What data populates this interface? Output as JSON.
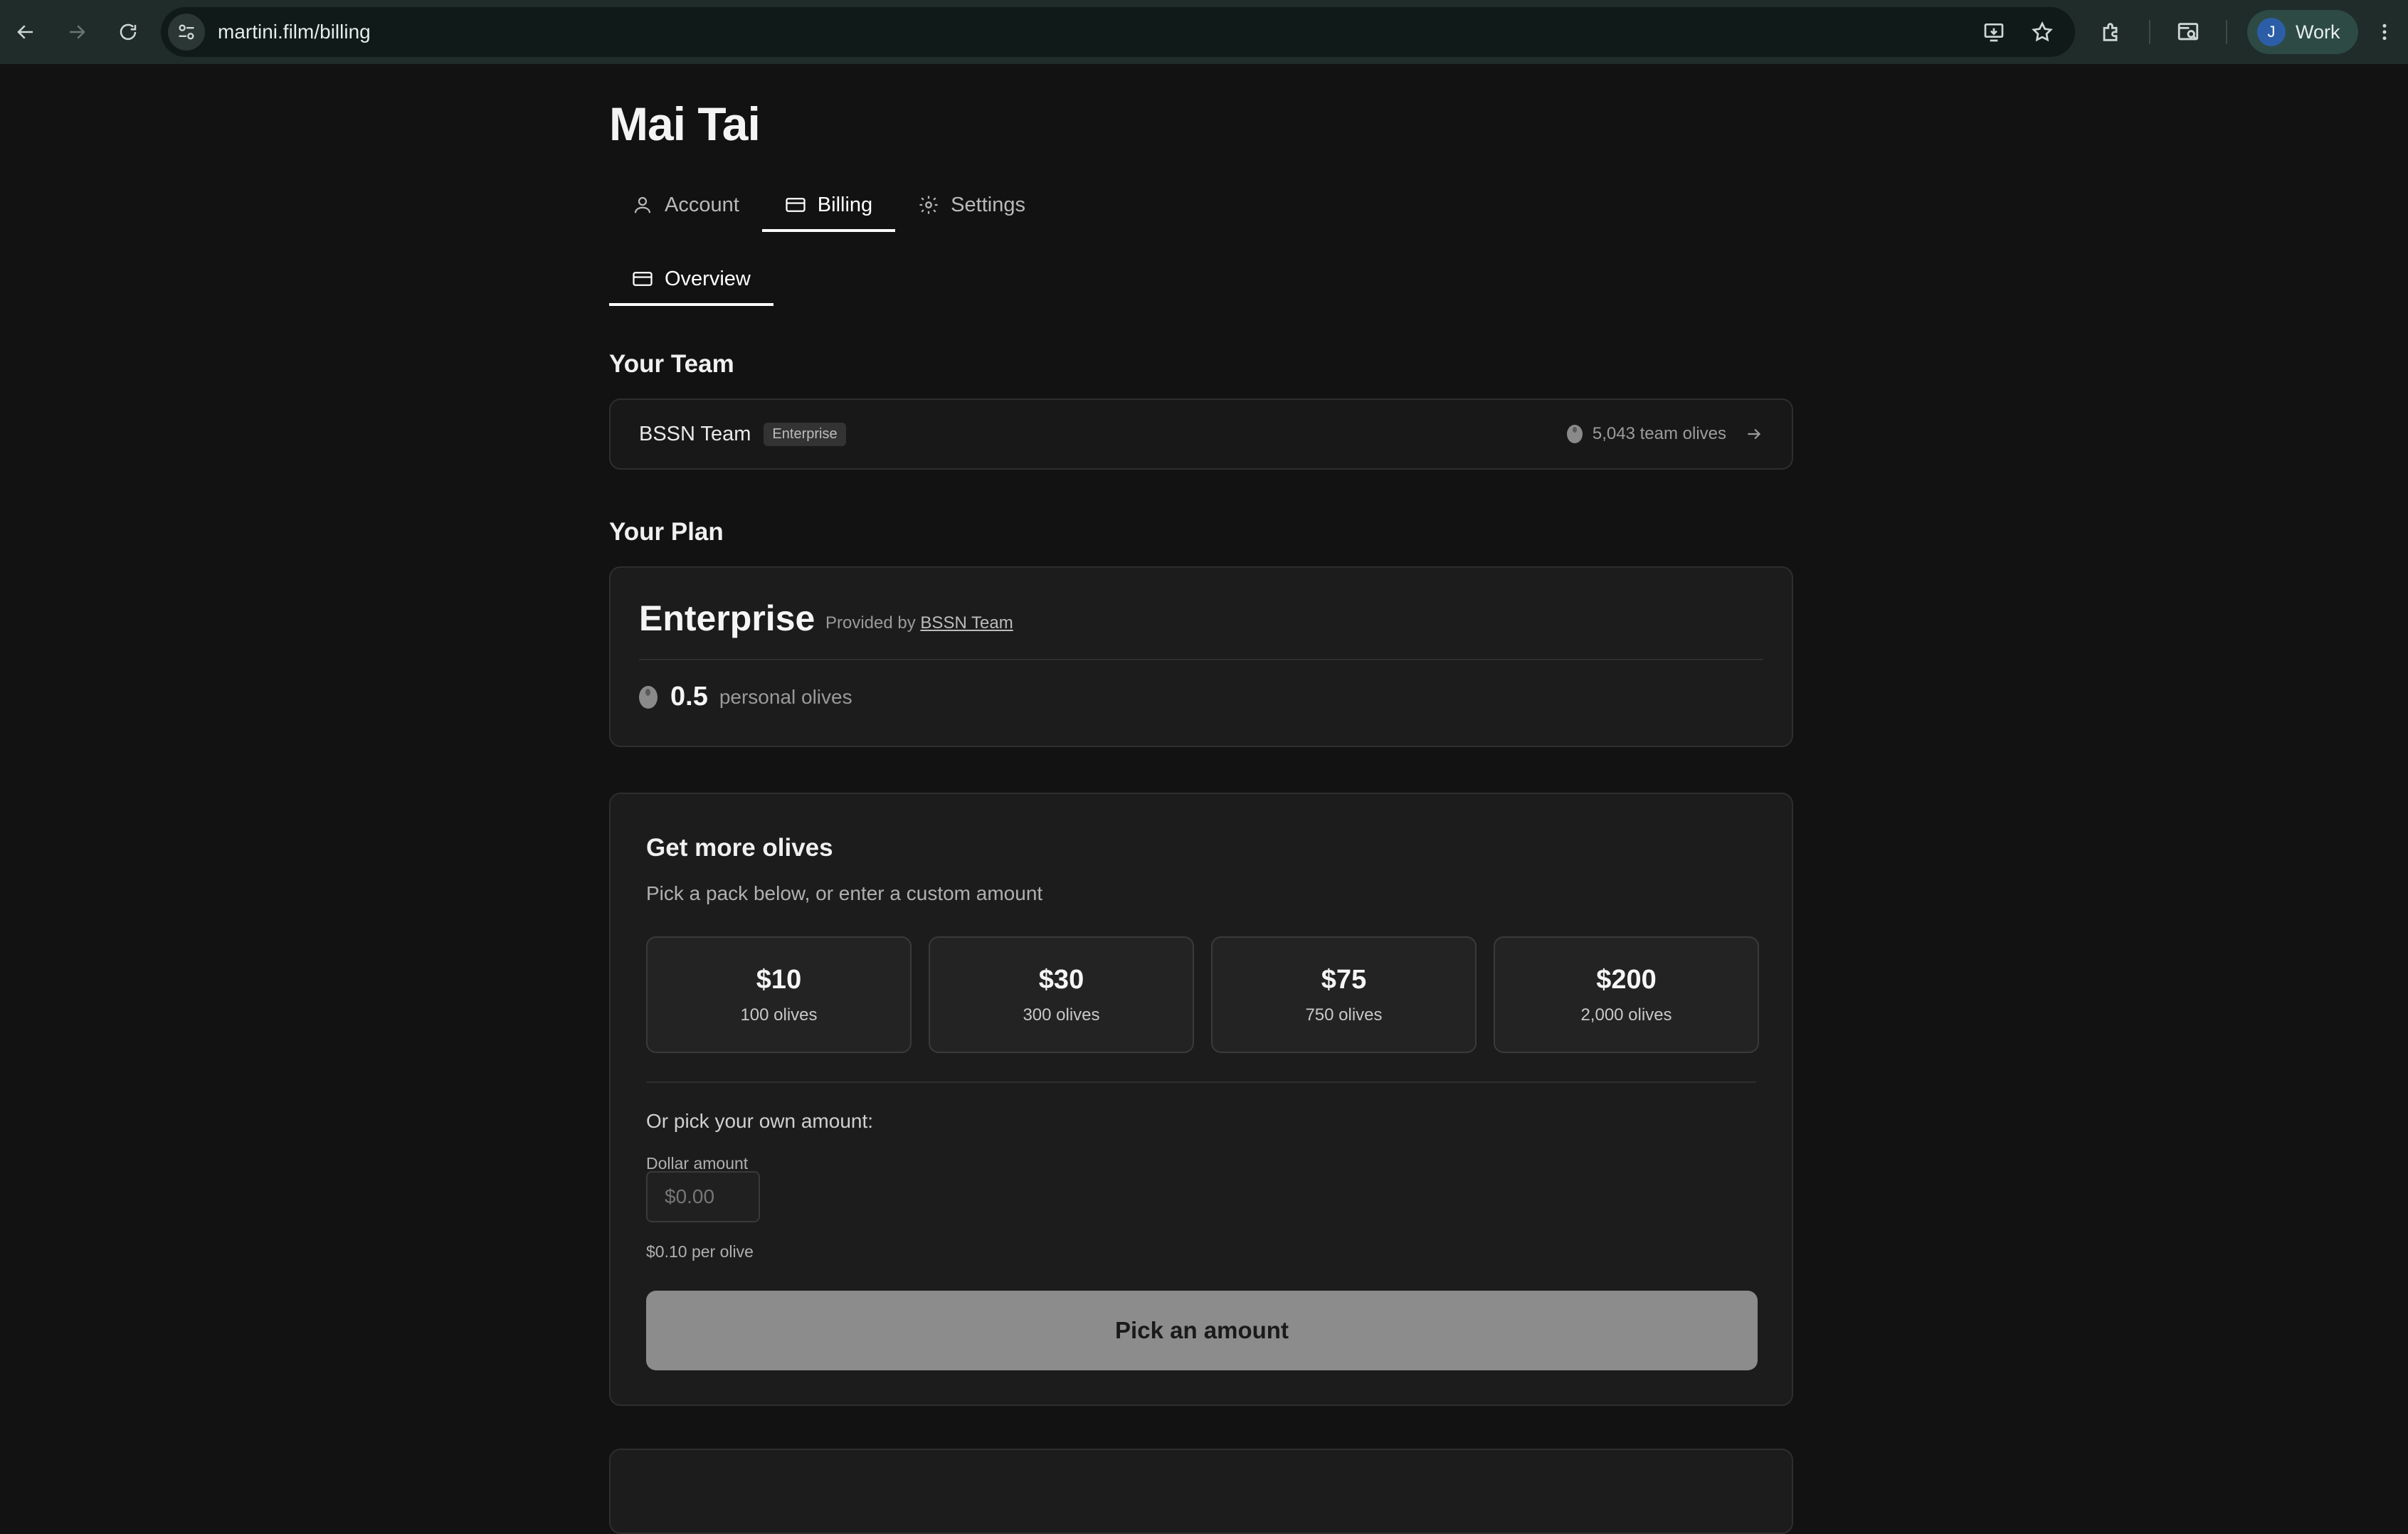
{
  "browser": {
    "url": "martini.film/billing",
    "profile_initial": "J",
    "profile_label": "Work"
  },
  "page": {
    "title": "Mai Tai",
    "tabs": [
      {
        "label": "Account",
        "icon": "user-icon"
      },
      {
        "label": "Billing",
        "icon": "credit-card-icon",
        "active": true
      },
      {
        "label": "Settings",
        "icon": "gear-icon"
      }
    ],
    "subtabs": [
      {
        "label": "Overview",
        "icon": "credit-card-icon",
        "active": true
      }
    ]
  },
  "team": {
    "section_title": "Your Team",
    "name": "BSSN Team",
    "badge": "Enterprise",
    "olives": "5,043 team olives"
  },
  "plan": {
    "section_title": "Your Plan",
    "name": "Enterprise",
    "provided_prefix": "Provided by",
    "provided_by": "BSSN Team",
    "balance": "0.5",
    "balance_unit": "personal olives"
  },
  "buy": {
    "title": "Get more olives",
    "subtitle": "Pick a pack below, or enter a custom amount",
    "packs": [
      {
        "price": "$10",
        "olives": "100 olives"
      },
      {
        "price": "$30",
        "olives": "300 olives"
      },
      {
        "price": "$75",
        "olives": "750 olives"
      },
      {
        "price": "$200",
        "olives": "2,000 olives"
      }
    ],
    "own_amount_label": "Or pick your own amount:",
    "field_label": "Dollar amount",
    "field_placeholder": "$0.00",
    "rate": "$0.10 per olive",
    "button_label": "Pick an amount"
  },
  "colors": {
    "background": "#121212",
    "card": "#1c1c1c",
    "button_disabled": "#8c8c8c",
    "chrome": "#1f2c2a"
  }
}
